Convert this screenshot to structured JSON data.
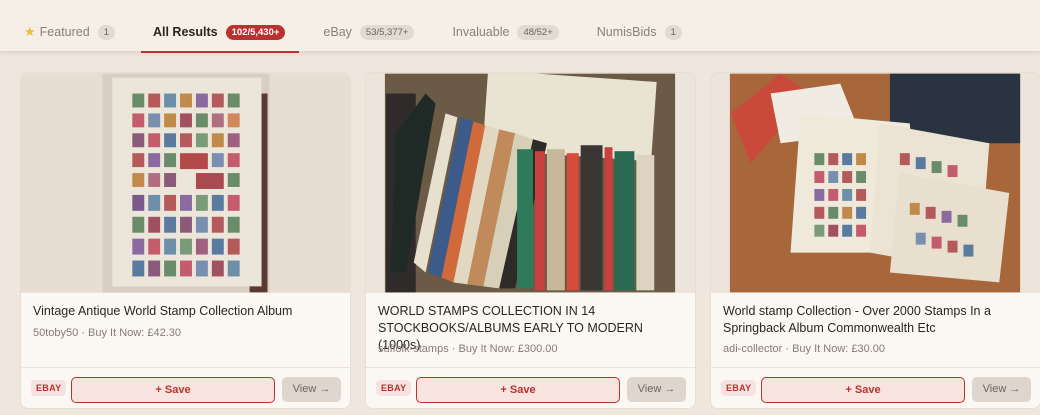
{
  "tabs": [
    {
      "label": "Featured",
      "count": "1"
    },
    {
      "label": "All Results",
      "count": "102/5,430+"
    },
    {
      "label": "eBay",
      "count": "53/5,377+"
    },
    {
      "label": "Invaluable",
      "count": "48/52+"
    },
    {
      "label": "NumisBids",
      "count": "1"
    }
  ],
  "cards": [
    {
      "title": "Vintage Antique World Stamp Collection Album",
      "meta": "50toby50 · Buy It Now: £42.30",
      "source": "EBAY",
      "save_label": "+ Save",
      "view_label": "View →"
    },
    {
      "title": "WORLD STAMPS COLLECTION IN 14 STOCKBOOKS/ALBUMS EARLY TO MODERN (1000s)",
      "meta": "suffolk-stamps · Buy It Now: £300.00",
      "source": "EBAY",
      "save_label": "+ Save",
      "view_label": "View →"
    },
    {
      "title": "World stamp Collection - Over 2000 Stamps In a Springback Album Commonwealth Etc",
      "meta": "adi-collector · Buy It Now: £30.00",
      "source": "EBAY",
      "save_label": "+ Save",
      "view_label": "View →"
    }
  ],
  "colors": {
    "accent": "#b8322f",
    "background": "#efe6dd",
    "card": "#fbf8f4"
  }
}
